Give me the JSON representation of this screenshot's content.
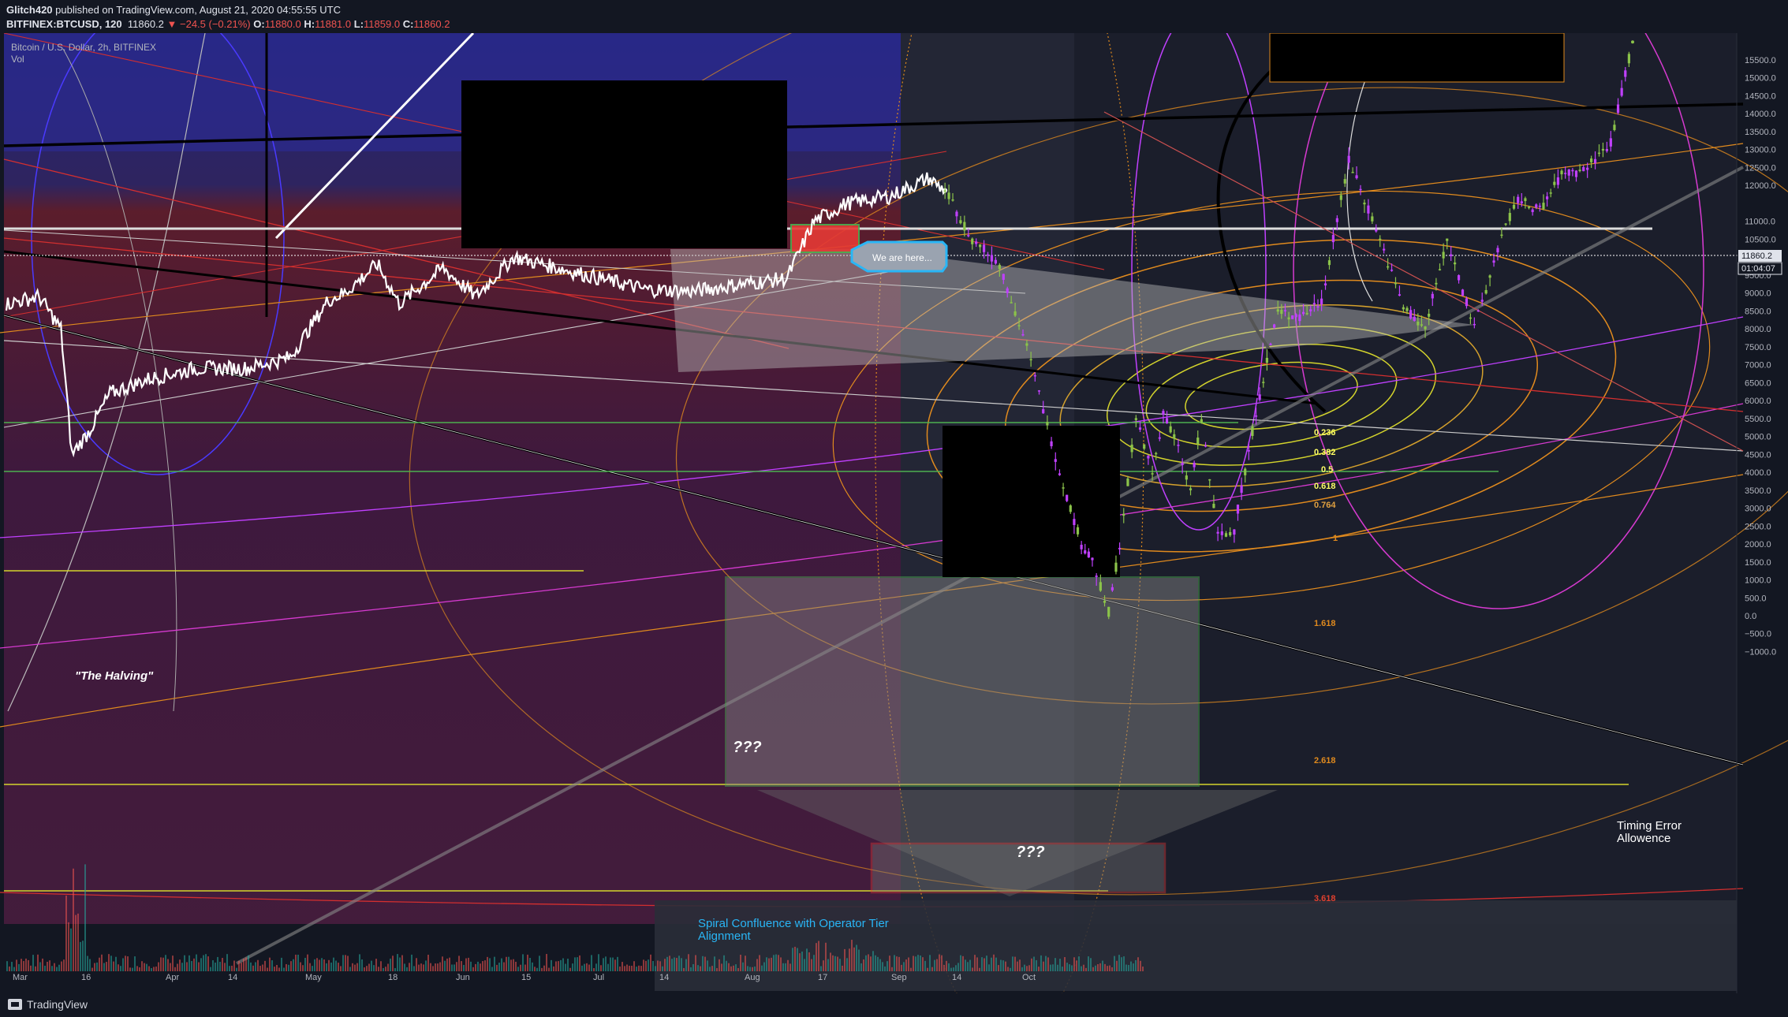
{
  "header": {
    "publisher": "Glitch420",
    "published_text": "published on TradingView.com, August 21, 2020 04:55:55 UTC",
    "symbol": "BITFINEX:BTCUSD, 120",
    "last": "11860.2",
    "change": "▼ −24.5 (−0.21%)",
    "open_label": "O:",
    "open": "11880.0",
    "high_label": "H:",
    "high": "11881.0",
    "low_label": "L:",
    "low": "11859.0",
    "close_label": "C:",
    "close": "11860.2"
  },
  "chart_title": "Bitcoin / U.S. Dollar, 2h, BITFINEX",
  "volume_label": "Vol",
  "footer": {
    "brand": "TradingView"
  },
  "price_tag": {
    "value": "11860.2",
    "countdown": "01:04:07"
  },
  "colors": {
    "background": "#131722",
    "price_line": "#ffffff",
    "projection_candle": "#8bc34a",
    "projection_wick": "#c040ff",
    "axis_text": "#b2b5be",
    "orange_lines": "#e08a1e",
    "yellow_lines": "#d4d42c",
    "magenta_lines": "#d63ad0",
    "red_lines": "#d32f2f"
  },
  "chart_data": {
    "type": "line",
    "x_axis_ticks": [
      "Mar",
      "16",
      "Apr",
      "14",
      "May",
      "18",
      "Jun",
      "15",
      "Jul",
      "14",
      "Aug",
      "17",
      "Sep",
      "14",
      "Oct"
    ],
    "y_axis_ticks": [
      "15500.0",
      "15000.0",
      "14500.0",
      "14000.0",
      "13500.0",
      "13000.0",
      "12500.0",
      "12000.0",
      "11000.0",
      "10500.0",
      "10000.0",
      "9500.0",
      "9000.0",
      "8500.0",
      "8000.0",
      "7500.0",
      "7000.0",
      "6500.0",
      "6000.0",
      "5500.0",
      "5000.0",
      "4500.0",
      "4000.0",
      "3500.0",
      "3000.0",
      "2500.0",
      "2000.0",
      "1500.0",
      "1000.0",
      "500.0",
      "0.0",
      "−500.0",
      "−1000.0"
    ],
    "ylim": [
      -1250,
      15750
    ],
    "series": [
      {
        "x": [
          "2020-03-01",
          "2020-03-07",
          "2020-03-11",
          "2020-03-13",
          "2020-03-16",
          "2020-03-20",
          "2020-03-27",
          "2020-04-05",
          "2020-04-14",
          "2020-04-22",
          "2020-04-29",
          "2020-05-02",
          "2020-05-08",
          "2020-05-12",
          "2020-05-20",
          "2020-05-26",
          "2020-06-02",
          "2020-06-10",
          "2020-06-18",
          "2020-06-26",
          "2020-07-05",
          "2020-07-14",
          "2020-07-22",
          "2020-07-27",
          "2020-08-02",
          "2020-08-10",
          "2020-08-17",
          "2020-08-20"
        ],
        "values": [
          8700,
          8900,
          8000,
          4500,
          5100,
          6200,
          6600,
          6900,
          6900,
          7200,
          8800,
          9000,
          9800,
          8700,
          9700,
          8900,
          10000,
          9700,
          9400,
          9100,
          9050,
          9250,
          9400,
          11000,
          11500,
          11700,
          12200,
          11860
        ]
      },
      {
        "x": [
          "2020-08-20",
          "2020-08-25",
          "2020-08-30",
          "2020-09-04",
          "2020-09-10",
          "2020-09-14",
          "2020-09-16",
          "2020-09-19",
          "2020-09-21",
          "2020-09-24",
          "2020-09-27",
          "2020-09-29",
          "2020-10-01",
          "2020-10-04",
          "2020-10-06",
          "2020-10-09",
          "2020-10-12",
          "2020-10-16",
          "2020-10-20",
          "2020-10-24",
          "2020-10-28",
          "2020-11-02",
          "2020-11-07",
          "2020-11-12",
          "2020-11-16",
          "2020-11-20",
          "2020-11-25",
          "2020-11-30",
          "2020-12-03",
          "2020-12-07",
          "2020-12-11",
          "2020-12-15",
          "2020-12-20",
          "2020-12-24"
        ],
        "values": [
          11860,
          10500,
          9800,
          7500,
          4000,
          2000,
          1500,
          100,
          2000,
          5500,
          4000,
          5600,
          5000,
          3500,
          5500,
          2200,
          2400,
          5700,
          8500,
          8300,
          8800,
          12700,
          10800,
          8600,
          8000,
          10500,
          8000,
          10600,
          11600,
          11300,
          12300,
          12400,
          13200,
          16000
        ]
      }
    ],
    "annotations": [
      "\"The Halving\"",
      "We are here...",
      "???",
      "???",
      "Spiral Confluence with Operator Tier Alignment",
      "Timing Error Allowence"
    ],
    "fib_labels": [
      "0.236",
      "0.382",
      "0.5",
      "0.618",
      "0.764",
      "1",
      "1.618",
      "2.618",
      "3.618"
    ],
    "grid": false
  }
}
